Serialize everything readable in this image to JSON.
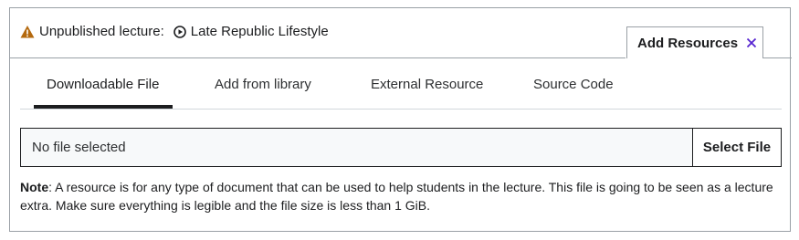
{
  "header": {
    "status_label": "Unpublished lecture:",
    "lecture_title": "Late Republic Lifestyle",
    "status_icon": "warning-icon",
    "lecture_icon": "play-circle-icon",
    "warning_color": "#b4690e"
  },
  "panel": {
    "title": "Add Resources",
    "close_icon": "close-icon",
    "close_color": "#5624d0"
  },
  "tabs": [
    {
      "label": "Downloadable File",
      "active": true
    },
    {
      "label": "Add from library",
      "active": false
    },
    {
      "label": "External Resource",
      "active": false
    },
    {
      "label": "Source Code",
      "active": false
    }
  ],
  "file": {
    "value": "No file selected",
    "button_label": "Select File"
  },
  "note": {
    "prefix": "Note",
    "text": ": A resource is for any type of document that can be used to help students in the lecture. This file is going to be seen as a lecture extra. Make sure everything is legible and the file size is less than 1 GiB."
  }
}
